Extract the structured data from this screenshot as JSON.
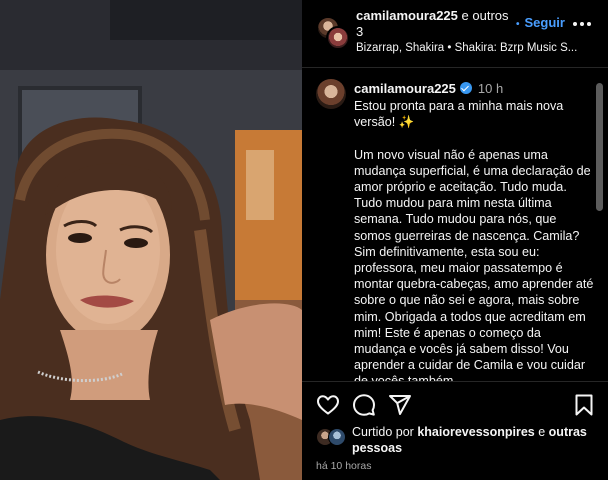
{
  "header": {
    "username": "camilamoura225",
    "connector": "e outros 3",
    "follow_label": "Seguir",
    "music": "Bizarrap, Shakira • Shakira: Bzrp Music S..."
  },
  "caption": {
    "username": "camilamoura225",
    "time": "10 h",
    "text": "Estou pronta para a minha mais nova versão! ✨\n\nUm novo visual não é apenas uma mudança superficial, é uma declaração de amor próprio e aceitação. Tudo muda. Tudo mudou para mim nesta última semana. Tudo mudou para nós, que somos guerreiras de nascença. Camila? Sim definitivamente, esta sou eu: professora, meu maior passatempo é montar quebra-cabeças, amo aprender até sobre o que não sei e agora, mais sobre mim. Obrigada a todos que acreditam em mim! Este é apenas o começo da mudança e vocês já sabem disso! Vou aprender a cuidar de Camila e vou cuidar de vocês também."
  },
  "likes": {
    "prefix": "Curtido por",
    "user": "khaiorevessonpires",
    "suffix": "e",
    "others": "outras pessoas"
  },
  "posted_ago": "há 10 horas",
  "icons": {
    "like": "heart-icon",
    "comment": "comment-icon",
    "share": "share-icon",
    "save": "bookmark-icon",
    "more": "more-icon",
    "verified": "verified-icon"
  },
  "colors": {
    "background": "#000000",
    "text": "#f5f5f5",
    "secondary": "#a8a8a8",
    "accent": "#4a9eff",
    "verified": "#3897f0"
  }
}
